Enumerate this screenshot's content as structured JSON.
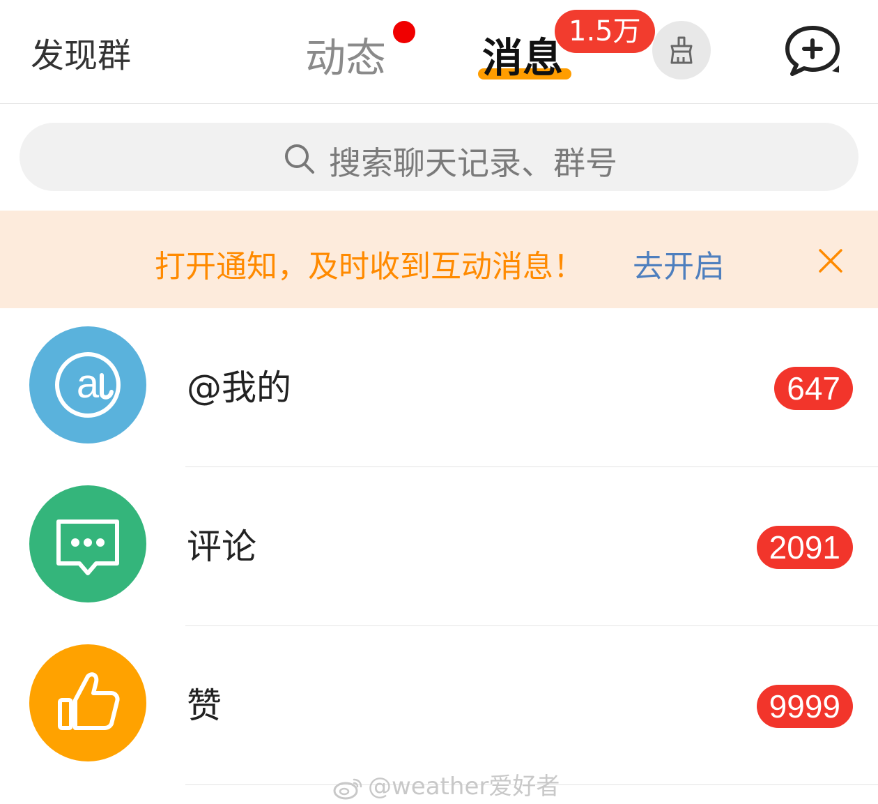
{
  "header": {
    "discover_groups": "发现群",
    "tabs": [
      {
        "label": "动态",
        "has_dot": true
      },
      {
        "label": "消息",
        "active": true
      }
    ],
    "message_badge": "1.5万",
    "icons": {
      "clean": "broom-icon",
      "new_chat": "chat-plus-icon"
    }
  },
  "search": {
    "placeholder": "搜索聊天记录、群号"
  },
  "notice": {
    "text": "打开通知，及时收到互动消息！",
    "action": "去开启"
  },
  "list": [
    {
      "label": "@我的",
      "count": "647",
      "color": "#5ab2dc",
      "icon": "at-icon"
    },
    {
      "label": "评论",
      "count": "2091",
      "color": "#34b57b",
      "icon": "comment-icon"
    },
    {
      "label": "赞",
      "count": "9999",
      "color": "#ffa200",
      "icon": "thumbs-up-icon"
    }
  ],
  "watermark": "@weather爱好者",
  "colors": {
    "accent": "#ff9d00",
    "badge": "#f2352b",
    "notice_text": "#ff8a00",
    "link": "#4e7fbe"
  }
}
